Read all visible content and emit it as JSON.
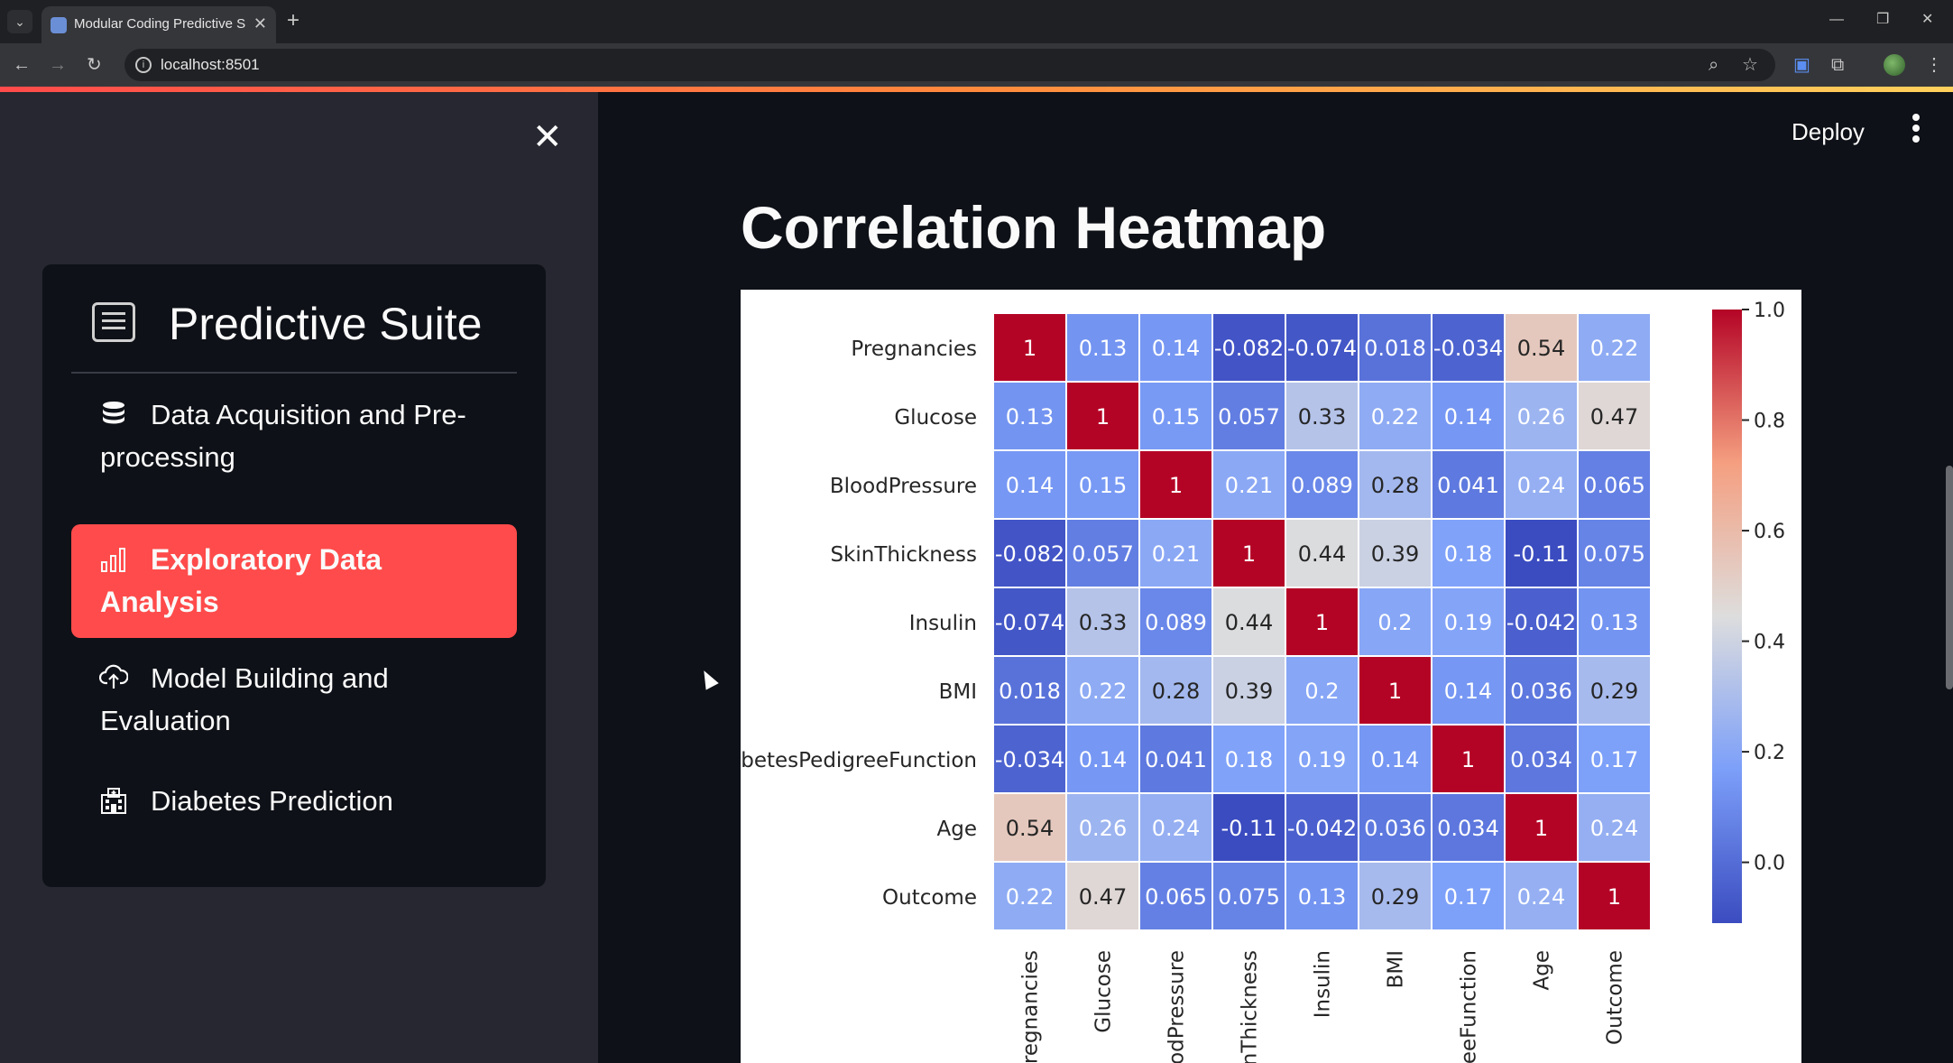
{
  "browser": {
    "tab_title": "Modular Coding Predictive Suite",
    "url": "localhost:8501"
  },
  "sidebar": {
    "title": "Predictive Suite",
    "items": [
      {
        "label": "Data Acquisition and Pre-processing",
        "icon": "database-icon",
        "active": false
      },
      {
        "label": "Exploratory Data Analysis",
        "icon": "bar-chart-icon",
        "active": true
      },
      {
        "label": "Model Building and Evaluation",
        "icon": "cloud-upload-icon",
        "active": false
      },
      {
        "label": "Diabetes Prediction",
        "icon": "hospital-icon",
        "active": false
      }
    ]
  },
  "header": {
    "deploy_label": "Deploy"
  },
  "main": {
    "title": "Correlation Heatmap"
  },
  "colors": {
    "accent": "#ff4b4b",
    "app_bg": "#0e1117",
    "sidebar_bg": "#262730",
    "cmap_low": "#3b4cc0",
    "cmap_mid": "#dddddd",
    "cmap_high": "#b40426"
  },
  "chart_data": {
    "type": "heatmap",
    "labels": [
      "Pregnancies",
      "Glucose",
      "BloodPressure",
      "SkinThickness",
      "Insulin",
      "BMI",
      "DiabetesPedigreeFunction",
      "Age",
      "Outcome"
    ],
    "x_tick_labels": [
      "Pregnancies",
      "Glucose",
      "oodPressure",
      "kinThickness",
      "Insulin",
      "BMI",
      "greeFunction",
      "Age",
      "Outcome"
    ],
    "values": [
      [
        "1",
        "0.13",
        "0.14",
        "-0.082",
        "-0.074",
        "0.018",
        "-0.034",
        "0.54",
        "0.22"
      ],
      [
        "0.13",
        "1",
        "0.15",
        "0.057",
        "0.33",
        "0.22",
        "0.14",
        "0.26",
        "0.47"
      ],
      [
        "0.14",
        "0.15",
        "1",
        "0.21",
        "0.089",
        "0.28",
        "0.041",
        "0.24",
        "0.065"
      ],
      [
        "-0.082",
        "0.057",
        "0.21",
        "1",
        "0.44",
        "0.39",
        "0.18",
        "-0.11",
        "0.075"
      ],
      [
        "-0.074",
        "0.33",
        "0.089",
        "0.44",
        "1",
        "0.2",
        "0.19",
        "-0.042",
        "0.13"
      ],
      [
        "0.018",
        "0.22",
        "0.28",
        "0.39",
        "0.2",
        "1",
        "0.14",
        "0.036",
        "0.29"
      ],
      [
        "-0.034",
        "0.14",
        "0.041",
        "0.18",
        "0.19",
        "0.14",
        "1",
        "0.034",
        "0.17"
      ],
      [
        "0.54",
        "0.26",
        "0.24",
        "-0.11",
        "-0.042",
        "0.036",
        "0.034",
        "1",
        "0.24"
      ],
      [
        "0.22",
        "0.47",
        "0.065",
        "0.075",
        "0.13",
        "0.29",
        "0.17",
        "0.24",
        "1"
      ]
    ],
    "colorbar": {
      "ticks": [
        "1.0",
        "0.8",
        "0.6",
        "0.4",
        "0.2",
        "0.0"
      ],
      "range": [
        -0.11,
        1.0
      ]
    },
    "colormap": "coolwarm",
    "annotations": true
  }
}
